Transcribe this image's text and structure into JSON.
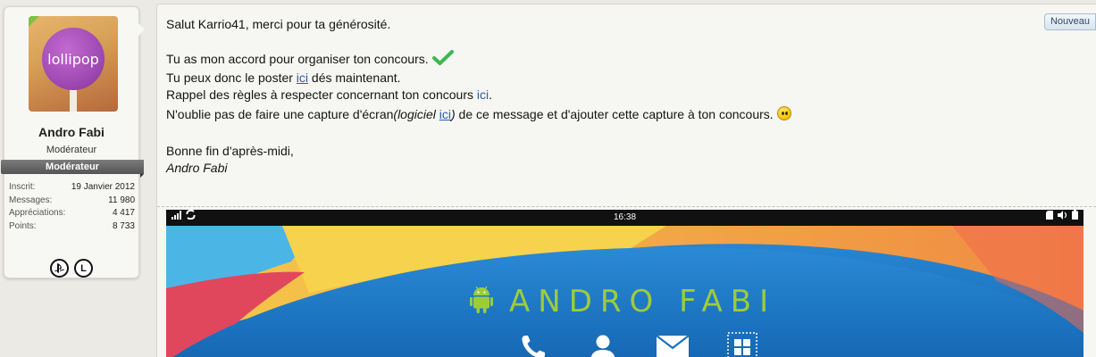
{
  "user": {
    "avatar_text": "lollipop",
    "name": "Andro Fabi",
    "title": "Modérateur",
    "banner": "Modérateur",
    "stats": [
      {
        "label": "Inscrit:",
        "value": "19 Janvier 2012"
      },
      {
        "label": "Messages:",
        "value": "11 980"
      },
      {
        "label": "Appréciations:",
        "value": "4 417"
      },
      {
        "label": "Points:",
        "value": "8 733"
      }
    ],
    "badges": [
      "playstation-icon",
      "L-icon"
    ],
    "badge_L": "L"
  },
  "message": {
    "new_label": "Nouveau",
    "line1": "Salut Karrio41, merci pour ta générosité.",
    "line2": "Tu as mon accord pour organiser ton concours.",
    "line3_pre": "Tu peux donc le poster ",
    "line3_link": "ici",
    "line3_post": " dés maintenant.",
    "line4_pre": "Rappel des règles à respecter concernant ton concours ",
    "line4_link": "ici",
    "line4_post": ".",
    "line5_pre": "N'oublie pas de faire une capture d'écran",
    "line5_italic_pre": "(logiciel ",
    "line5_link": "ici",
    "line5_italic_post": ")",
    "line5_post": " de ce message et d'ajouter cette capture à ton concours.",
    "line6": "Bonne fin d'après-midi,",
    "signature": "Andro Fabi"
  },
  "phone": {
    "time": "16:38",
    "brand": "ANDRO FABI"
  },
  "colors": {
    "link": "#2b5ca6",
    "check": "#3cb853",
    "brand_green": "#9ccc3c",
    "banner_gray": "#666666"
  }
}
